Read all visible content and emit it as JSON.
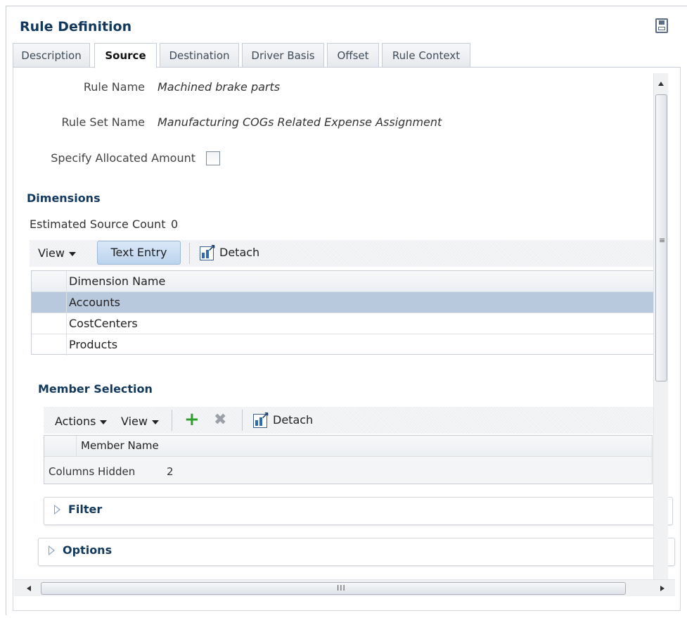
{
  "header": {
    "title": "Rule Definition",
    "save_icon": "save-icon"
  },
  "tabs": [
    {
      "label": "Description",
      "active": false
    },
    {
      "label": "Source",
      "active": true
    },
    {
      "label": "Destination",
      "active": false
    },
    {
      "label": "Driver Basis",
      "active": false
    },
    {
      "label": "Offset",
      "active": false
    },
    {
      "label": "Rule Context",
      "active": false
    }
  ],
  "form": {
    "rule_name_label": "Rule Name",
    "rule_name_value": "Machined brake parts",
    "rule_set_label": "Rule Set Name",
    "rule_set_value": "Manufacturing COGs Related Expense Assignment",
    "allocated_label": "Specify Allocated Amount",
    "allocated_checked": false
  },
  "dimensions": {
    "title": "Dimensions",
    "count_label": "Estimated Source Count",
    "count_value": "0",
    "toolbar": {
      "view": "View",
      "text_entry": "Text Entry",
      "detach": "Detach"
    },
    "column": "Dimension Name",
    "rows": [
      "Accounts",
      "CostCenters",
      "Products"
    ],
    "selected_index": 0
  },
  "member_selection": {
    "title": "Member Selection",
    "toolbar": {
      "actions": "Actions",
      "view": "View",
      "detach": "Detach"
    },
    "column": "Member Name",
    "hidden_label": "Columns Hidden",
    "hidden_value": "2"
  },
  "sections": {
    "filter": "Filter",
    "options": "Options"
  },
  "colors": {
    "heading": "#12395d",
    "selected_row": "#b9c9dd",
    "add_icon": "#2e9e2e"
  }
}
